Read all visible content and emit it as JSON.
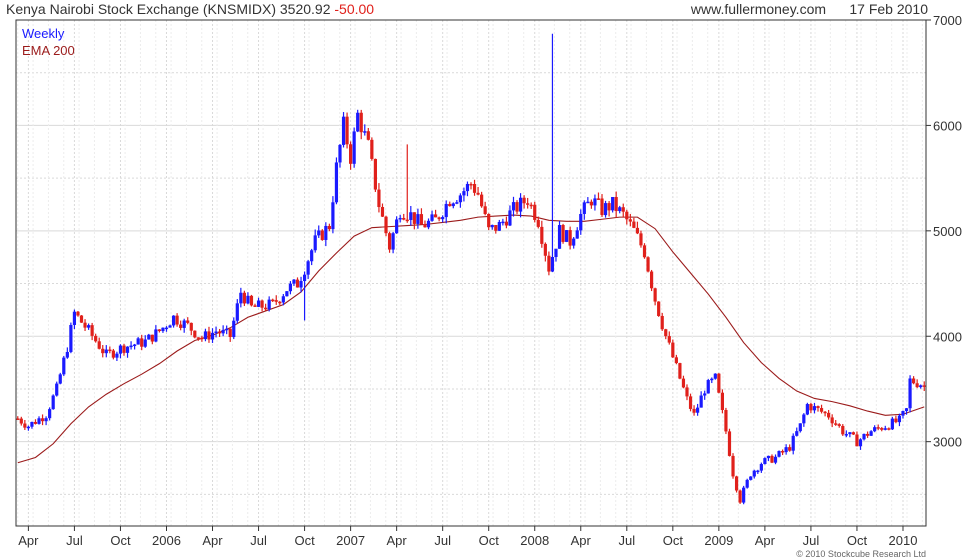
{
  "header": {
    "title": "Kenya Nairobi Stock Exchange (KNSMIDX)",
    "last": "3520.92",
    "change": "-50.00",
    "site": "www.fullermoney.com",
    "date": "17 Feb 2010"
  },
  "footer": {
    "copyright": "© 2010 Stockcube Research Ltd"
  },
  "colors": {
    "up": "#1a1aff",
    "down": "#e0201b",
    "ema": "#9b1b1b",
    "grid": "#d9d9d9",
    "axis": "#333333"
  },
  "chart_data": {
    "type": "ohlc",
    "grid": true,
    "legend_position": "top-left",
    "ylim": [
      2200,
      7000
    ],
    "y_ticks": [
      3000,
      4000,
      5000,
      6000,
      7000
    ],
    "x_ticks": [
      {
        "label": "Apr",
        "week": 3
      },
      {
        "label": "Jul",
        "week": 16
      },
      {
        "label": "Oct",
        "week": 29
      },
      {
        "label": "2006",
        "week": 42
      },
      {
        "label": "Apr",
        "week": 55
      },
      {
        "label": "Jul",
        "week": 68
      },
      {
        "label": "Oct",
        "week": 81
      },
      {
        "label": "2007",
        "week": 94
      },
      {
        "label": "Apr",
        "week": 107
      },
      {
        "label": "Jul",
        "week": 120
      },
      {
        "label": "Oct",
        "week": 133
      },
      {
        "label": "2008",
        "week": 146
      },
      {
        "label": "Apr",
        "week": 159
      },
      {
        "label": "Jul",
        "week": 172
      },
      {
        "label": "Oct",
        "week": 185
      },
      {
        "label": "2009",
        "week": 198
      },
      {
        "label": "Apr",
        "week": 211
      },
      {
        "label": "Jul",
        "week": 224
      },
      {
        "label": "Oct",
        "week": 237
      },
      {
        "label": "2010",
        "week": 250
      }
    ],
    "x_range": [
      -0.5,
      256.5
    ],
    "series": [
      {
        "name": "Weekly",
        "kind": "ohlc"
      },
      {
        "name": "EMA 200",
        "kind": "line"
      }
    ],
    "price_anchors": [
      [
        0,
        3220
      ],
      [
        3,
        3150
      ],
      [
        8,
        3260
      ],
      [
        11,
        3500
      ],
      [
        14,
        3900
      ],
      [
        16,
        4220
      ],
      [
        20,
        4050
      ],
      [
        25,
        3820
      ],
      [
        30,
        3900
      ],
      [
        36,
        3950
      ],
      [
        40,
        4050
      ],
      [
        44,
        4180
      ],
      [
        48,
        4100
      ],
      [
        52,
        3980
      ],
      [
        56,
        4050
      ],
      [
        60,
        4000
      ],
      [
        63,
        4420
      ],
      [
        66,
        4270
      ],
      [
        72,
        4300
      ],
      [
        76,
        4450
      ],
      [
        79,
        4500
      ],
      [
        81,
        4650
      ],
      [
        84,
        4900
      ],
      [
        88,
        5050
      ],
      [
        90,
        5600
      ],
      [
        92,
        6000
      ],
      [
        94,
        5700
      ],
      [
        96,
        6100
      ],
      [
        99,
        5800
      ],
      [
        102,
        5250
      ],
      [
        105,
        4850
      ],
      [
        108,
        5200
      ],
      [
        111,
        5150
      ],
      [
        114,
        5050
      ],
      [
        118,
        5100
      ],
      [
        122,
        5300
      ],
      [
        125,
        5350
      ],
      [
        128,
        5450
      ],
      [
        130,
        5350
      ],
      [
        133,
        5000
      ],
      [
        136,
        5050
      ],
      [
        140,
        5200
      ],
      [
        144,
        5300
      ],
      [
        147,
        5100
      ],
      [
        150,
        4650
      ],
      [
        153,
        5000
      ],
      [
        156,
        4900
      ],
      [
        159,
        5150
      ],
      [
        162,
        5300
      ],
      [
        165,
        5200
      ],
      [
        168,
        5250
      ],
      [
        171,
        5150
      ],
      [
        174,
        5000
      ],
      [
        177,
        4800
      ],
      [
        180,
        4350
      ],
      [
        183,
        4000
      ],
      [
        186,
        3700
      ],
      [
        189,
        3400
      ],
      [
        191,
        3250
      ],
      [
        194,
        3500
      ],
      [
        197,
        3600
      ],
      [
        200,
        3100
      ],
      [
        202,
        2700
      ],
      [
        204,
        2450
      ],
      [
        207,
        2700
      ],
      [
        210,
        2800
      ],
      [
        214,
        2850
      ],
      [
        218,
        2950
      ],
      [
        221,
        3150
      ],
      [
        223,
        3350
      ],
      [
        226,
        3300
      ],
      [
        229,
        3250
      ],
      [
        233,
        3100
      ],
      [
        237,
        3000
      ],
      [
        241,
        3100
      ],
      [
        245,
        3150
      ],
      [
        249,
        3200
      ],
      [
        251,
        3300
      ],
      [
        252,
        3580
      ],
      [
        255,
        3550
      ],
      [
        256,
        3520
      ]
    ],
    "spikes": [
      {
        "week": 110,
        "high": 5820
      },
      {
        "week": 151,
        "high": 6870
      },
      {
        "week": 81,
        "low": 4150
      }
    ],
    "ema_points": [
      [
        0,
        2800
      ],
      [
        5,
        2850
      ],
      [
        10,
        2980
      ],
      [
        15,
        3170
      ],
      [
        20,
        3330
      ],
      [
        25,
        3450
      ],
      [
        30,
        3550
      ],
      [
        35,
        3640
      ],
      [
        40,
        3740
      ],
      [
        45,
        3860
      ],
      [
        50,
        3960
      ],
      [
        55,
        4010
      ],
      [
        60,
        4080
      ],
      [
        65,
        4180
      ],
      [
        70,
        4240
      ],
      [
        75,
        4300
      ],
      [
        80,
        4420
      ],
      [
        85,
        4620
      ],
      [
        90,
        4790
      ],
      [
        95,
        4950
      ],
      [
        100,
        5030
      ],
      [
        105,
        5040
      ],
      [
        110,
        5050
      ],
      [
        115,
        5060
      ],
      [
        120,
        5080
      ],
      [
        125,
        5100
      ],
      [
        130,
        5130
      ],
      [
        135,
        5140
      ],
      [
        140,
        5150
      ],
      [
        145,
        5140
      ],
      [
        150,
        5100
      ],
      [
        155,
        5090
      ],
      [
        160,
        5090
      ],
      [
        165,
        5110
      ],
      [
        170,
        5130
      ],
      [
        175,
        5130
      ],
      [
        180,
        5020
      ],
      [
        185,
        4800
      ],
      [
        190,
        4600
      ],
      [
        195,
        4400
      ],
      [
        200,
        4180
      ],
      [
        205,
        3940
      ],
      [
        210,
        3750
      ],
      [
        215,
        3600
      ],
      [
        220,
        3480
      ],
      [
        225,
        3410
      ],
      [
        230,
        3380
      ],
      [
        235,
        3340
      ],
      [
        240,
        3290
      ],
      [
        245,
        3250
      ],
      [
        250,
        3260
      ],
      [
        256,
        3330
      ]
    ]
  }
}
